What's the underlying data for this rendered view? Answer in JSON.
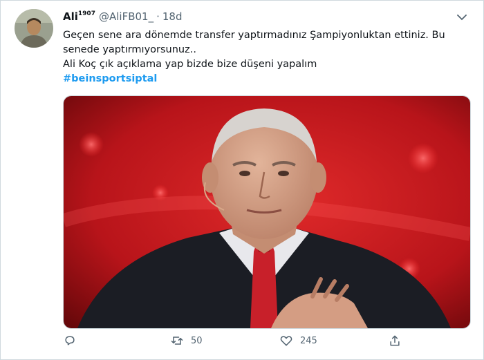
{
  "tweet": {
    "author": {
      "name": "Ali",
      "name_superscript": "1907",
      "handle": "@AliFB01_",
      "separator": "·",
      "time": "18d"
    },
    "text_lines": [
      "Geçen sene ara dönemde transfer yaptırmadınız Şampiyonluktan ettiniz. Bu",
      "senede yaptırmıyorsunuz..",
      "Ali Koç çık açıklama yap bizde bize düşeni yapalım"
    ],
    "hashtag": "#beinsportsiptal",
    "actions": {
      "reply_count": "",
      "retweet_count": "50",
      "like_count": "245"
    },
    "icons": [
      "chevron-down-icon",
      "reply-icon",
      "retweet-icon",
      "like-icon",
      "share-icon"
    ],
    "colors": {
      "hashtag": "#1d9bf0",
      "secondary_text": "#536471",
      "media_background": "#c8141a"
    }
  }
}
